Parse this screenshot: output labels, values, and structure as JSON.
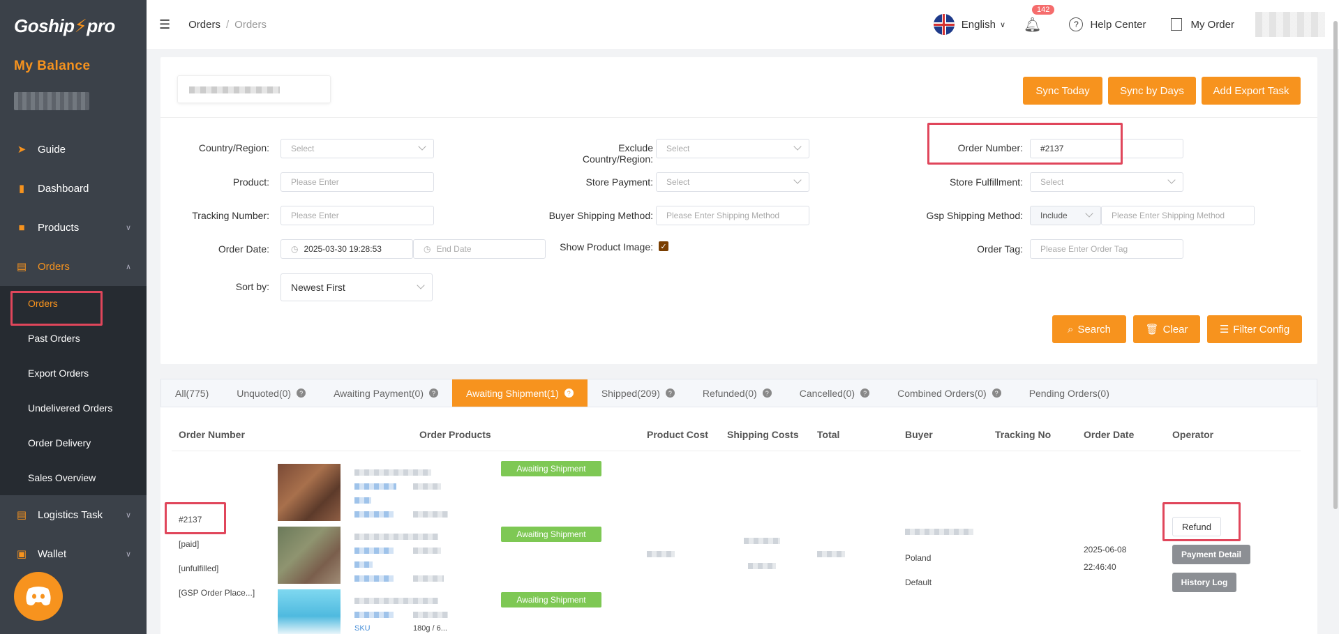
{
  "sidebar": {
    "logo_main": "Goship",
    "logo_accent": "pro",
    "balance_title": "My Balance",
    "items": [
      {
        "label": "Guide",
        "icon": "paper-plane-icon"
      },
      {
        "label": "Dashboard",
        "icon": "bar-chart-icon"
      },
      {
        "label": "Products",
        "icon": "bag-icon"
      },
      {
        "label": "Orders",
        "icon": "clipboard-icon"
      },
      {
        "label": "Logistics Task",
        "icon": "clipboard-icon"
      },
      {
        "label": "Wallet",
        "icon": "wallet-icon"
      }
    ],
    "sub_items": [
      {
        "label": "Orders"
      },
      {
        "label": "Past Orders"
      },
      {
        "label": "Export Orders"
      },
      {
        "label": "Undelivered Orders"
      },
      {
        "label": "Order Delivery"
      },
      {
        "label": "Sales Overview"
      }
    ]
  },
  "header": {
    "breadcrumb": [
      "Orders",
      "Orders"
    ],
    "language": "English",
    "notification_count": "142",
    "help_center": "Help Center",
    "my_order": "My Order"
  },
  "toolbar": {
    "sync_today": "Sync Today",
    "sync_by_days": "Sync by Days",
    "add_export_task": "Add Export Task"
  },
  "filters": {
    "country_region": {
      "label": "Country/Region:",
      "placeholder": "Select"
    },
    "exclude_country": {
      "label": "Exclude Country/Region:",
      "placeholder": "Select"
    },
    "order_number": {
      "label": "Order Number:",
      "value": "#2137"
    },
    "product": {
      "label": "Product:",
      "placeholder": "Please Enter"
    },
    "store_payment": {
      "label": "Store Payment:",
      "placeholder": "Select"
    },
    "store_fulfillment": {
      "label": "Store Fulfillment:",
      "placeholder": "Select"
    },
    "tracking_number": {
      "label": "Tracking Number:",
      "placeholder": "Please Enter"
    },
    "buyer_shipping": {
      "label": "Buyer Shipping Method:",
      "placeholder": "Please Enter Shipping Method"
    },
    "gsp_shipping": {
      "label": "Gsp Shipping Method:",
      "mode": "Include",
      "placeholder": "Please Enter Shipping Method"
    },
    "order_date": {
      "label": "Order Date:",
      "start": "2025-03-30 19:28:53",
      "end_placeholder": "End Date"
    },
    "show_image": {
      "label": "Show Product Image:",
      "checked": true
    },
    "order_tag": {
      "label": "Order Tag:",
      "placeholder": "Please Enter Order Tag"
    },
    "sort_by": {
      "label": "Sort by:",
      "value": "Newest First"
    },
    "search_btn": "Search",
    "clear_btn": "Clear",
    "filter_config_btn": "Filter Config"
  },
  "tabs": [
    {
      "label": "All(775)",
      "help": false
    },
    {
      "label": "Unquoted(0)",
      "help": true
    },
    {
      "label": "Awaiting Payment(0)",
      "help": true
    },
    {
      "label": "Awaiting Shipment(1)",
      "help": true,
      "active": true
    },
    {
      "label": "Shipped(209)",
      "help": true
    },
    {
      "label": "Refunded(0)",
      "help": true
    },
    {
      "label": "Cancelled(0)",
      "help": true
    },
    {
      "label": "Combined Orders(0)",
      "help": true
    },
    {
      "label": "Pending Orders(0)",
      "help": false
    }
  ],
  "table": {
    "headers": [
      "Order Number",
      "Order Products",
      "Product Cost",
      "Shipping Costs",
      "Total",
      "Buyer",
      "Tracking No",
      "Order Date",
      "Operator"
    ],
    "row": {
      "order_number": "#2137",
      "payment_status": "[paid]",
      "fulfillment_status": "[unfulfilled]",
      "gsp_status": "[GSP Order Place...]",
      "statuses": [
        "Awaiting Shipment",
        "Awaiting Shipment",
        "Awaiting Shipment"
      ],
      "sku_label": "SKU",
      "sku_partial": "180g / 6...",
      "buyer_country": "Poland",
      "buyer_method": "Default",
      "order_date": "2025-06-08",
      "order_time": "22:46:40",
      "refund_btn": "Refund",
      "payment_detail_btn": "Payment Detail",
      "history_log_btn": "History Log"
    }
  },
  "colors": {
    "accent": "#f7931e",
    "sidebar_bg": "#3b4149",
    "highlight": "#e0465b",
    "status_green": "#7ec854"
  }
}
